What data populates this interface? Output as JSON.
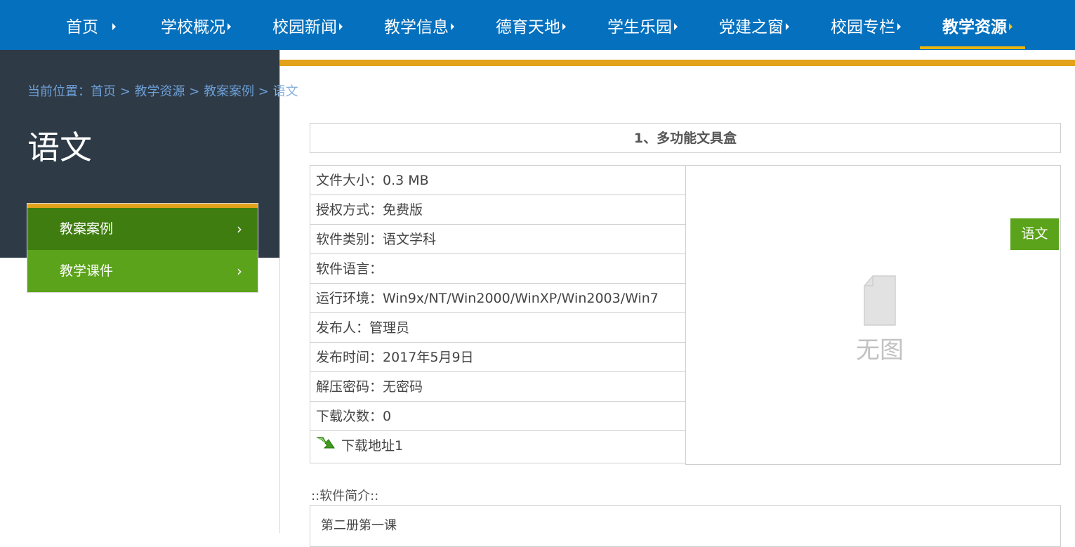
{
  "nav": {
    "items": [
      {
        "label": "首页"
      },
      {
        "label": "学校概况"
      },
      {
        "label": "校园新闻"
      },
      {
        "label": "教学信息"
      },
      {
        "label": "德育天地"
      },
      {
        "label": "学生乐园"
      },
      {
        "label": "党建之窗"
      },
      {
        "label": "校园专栏"
      },
      {
        "label": "教学资源"
      }
    ],
    "active_index": 8,
    "colors": {
      "bar": "#0470be",
      "underline": "#e8b60e"
    }
  },
  "breadcrumb": {
    "prefix": "当前位置：",
    "home": "首页",
    "level1": "教学资源",
    "level2": "教案案例",
    "current": "语文",
    "separator": " > "
  },
  "page": {
    "heading": "语文"
  },
  "side_menu": {
    "items": [
      {
        "label": "教案案例",
        "chevron": "›"
      },
      {
        "label": "教学课件",
        "chevron": "›"
      }
    ],
    "colors": {
      "primary": "#3f7d10",
      "secondary": "#5ba31a",
      "accent": "#e3a21a"
    }
  },
  "resource": {
    "title": "1、多功能文具盒",
    "rows": [
      {
        "label": "文件大小：",
        "value": "0.3 MB"
      },
      {
        "label": "授权方式：",
        "value": "免费版"
      },
      {
        "label": "软件类别：",
        "value": "语文学科"
      },
      {
        "label": "软件语言：",
        "value": ""
      },
      {
        "label": "运行环境：",
        "value": "Win9x/NT/Win2000/WinXP/Win2003/Win7"
      },
      {
        "label": "发布人：",
        "value": "管理员"
      },
      {
        "label": "发布时间：",
        "value": "2017年5月9日"
      },
      {
        "label": "解压密码：",
        "value": "无密码"
      },
      {
        "label": "下载次数：",
        "value": "0"
      }
    ],
    "download_link": "下载地址1",
    "download_icon": "download-arrow-icon",
    "no_image_text": "无图",
    "tag": "语文"
  },
  "intro": {
    "label": "::软件简介::",
    "text": "第二册第一课"
  }
}
